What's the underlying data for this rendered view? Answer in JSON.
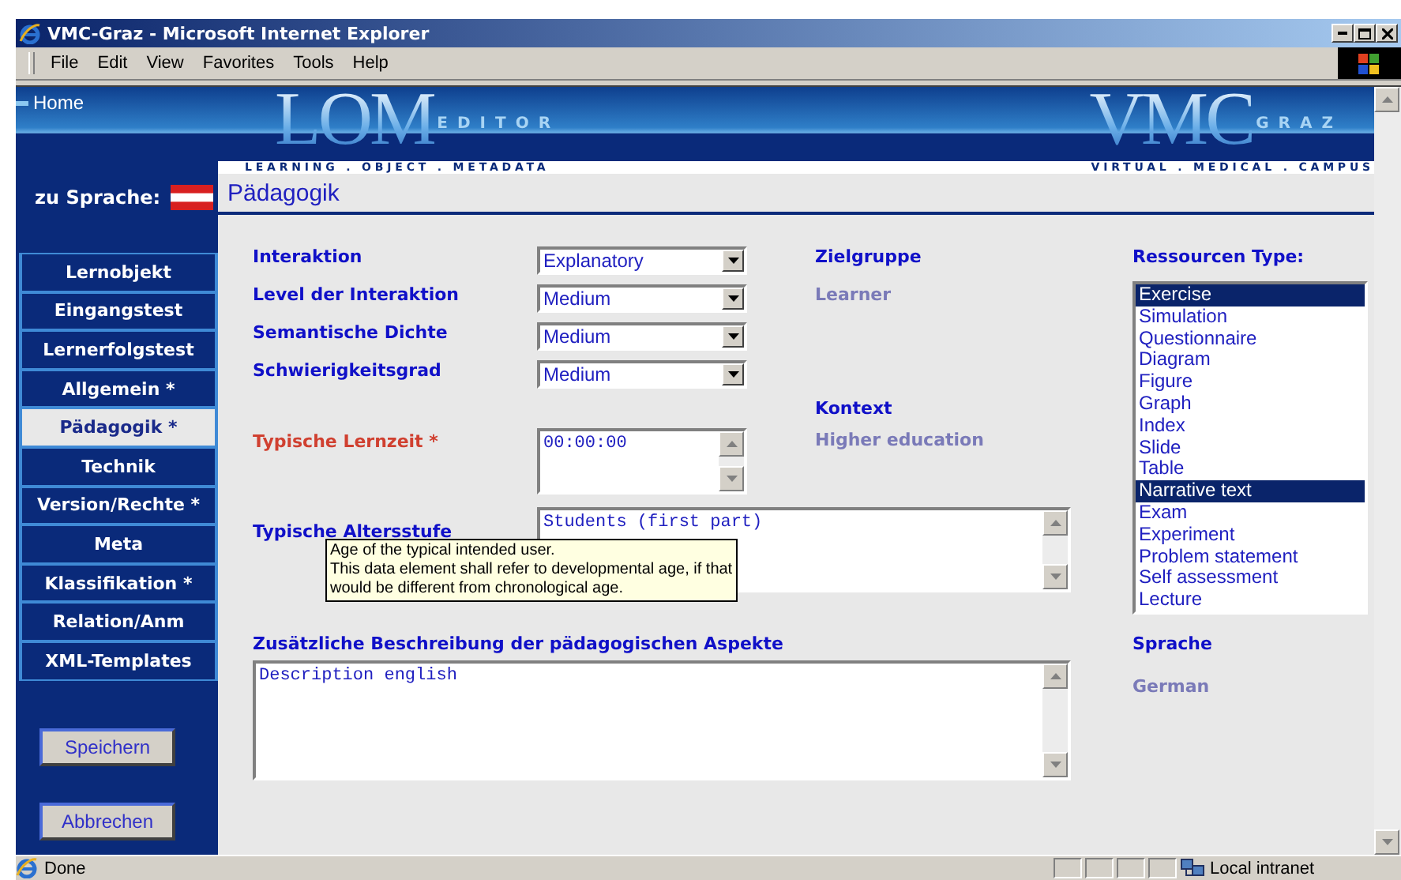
{
  "window": {
    "title": "VMC-Graz - Microsoft Internet Explorer"
  },
  "menu": [
    "File",
    "Edit",
    "View",
    "Favorites",
    "Tools",
    "Help"
  ],
  "header": {
    "home_link": "Home",
    "logo_main": "LOM",
    "logo_sub": "EDITOR",
    "tagline": "LEARNING . OBJECT . METADATA",
    "brand_main": "VMC",
    "brand_sub": "GRAZ",
    "brand_tagline": "VIRTUAL . MEDICAL . CAMPUS"
  },
  "language_switch": {
    "label": "zu Sprache:"
  },
  "page_title": "Pädagogik",
  "nav": [
    {
      "label": "Lernobjekt",
      "selected": false
    },
    {
      "label": "Eingangstest",
      "selected": false
    },
    {
      "label": "Lernerfolgstest",
      "selected": false
    },
    {
      "label": "Allgemein *",
      "selected": false
    },
    {
      "label": "Pädagogik *",
      "selected": true
    },
    {
      "label": "Technik",
      "selected": false
    },
    {
      "label": "Version/Rechte *",
      "selected": false
    },
    {
      "label": "Meta",
      "selected": false
    },
    {
      "label": "Klassifikation *",
      "selected": false
    },
    {
      "label": "Relation/Anm",
      "selected": false
    },
    {
      "label": "XML-Templates",
      "selected": false
    }
  ],
  "buttons": [
    "Speichern",
    "Abbrechen"
  ],
  "selects": [
    {
      "label": "Interaktion",
      "value": "Explanatory"
    },
    {
      "label": "Level der Interaktion",
      "value": "Medium"
    },
    {
      "label": "Semantische Dichte",
      "value": "Medium"
    },
    {
      "label": "Schwierigkeitsgrad",
      "value": "Medium"
    }
  ],
  "learning_time": {
    "label": "Typische Lernzeit *",
    "value": "00:00:00",
    "required": true
  },
  "age_range": {
    "label": "Typische Altersstufe",
    "value": "Students (first part)",
    "tooltip": [
      "Age of the typical intended user.",
      "This data element shall refer to developmental age, if that",
      "would be different from chronological age."
    ]
  },
  "description": {
    "label": "Zusätzliche Beschreibung der pädagogischen Aspekte",
    "value": "Description english"
  },
  "target_group": {
    "label": "Zielgruppe",
    "value": "Learner"
  },
  "context": {
    "label": "Kontext",
    "value": "Higher education"
  },
  "resource_types": {
    "label": "Ressourcen Type:",
    "items": [
      {
        "label": "Exercise",
        "selected": true
      },
      {
        "label": "Simulation",
        "selected": false
      },
      {
        "label": "Questionnaire",
        "selected": false
      },
      {
        "label": "Diagram",
        "selected": false
      },
      {
        "label": "Figure",
        "selected": false
      },
      {
        "label": "Graph",
        "selected": false
      },
      {
        "label": "Index",
        "selected": false
      },
      {
        "label": "Slide",
        "selected": false
      },
      {
        "label": "Table",
        "selected": false
      },
      {
        "label": "Narrative text",
        "selected": true
      },
      {
        "label": "Exam",
        "selected": false
      },
      {
        "label": "Experiment",
        "selected": false
      },
      {
        "label": "Problem statement",
        "selected": false
      },
      {
        "label": "Self assessment",
        "selected": false
      },
      {
        "label": "Lecture",
        "selected": false
      }
    ]
  },
  "language": {
    "label": "Sprache",
    "value": "German"
  },
  "status_bar": {
    "text": "Done",
    "zone": "Local intranet"
  }
}
